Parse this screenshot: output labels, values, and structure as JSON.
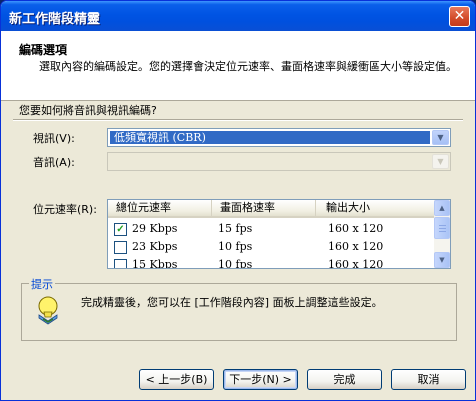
{
  "window": {
    "title": "新工作階段精靈",
    "close_glyph": "✕"
  },
  "header": {
    "title": "編碼選項",
    "description": "選取內容的編碼設定。您的選擇會決定位元速率、畫面格速率與緩衝區大小等設定值。"
  },
  "question": "您要如何將音訊與視訊編碼?",
  "video": {
    "label": "視訊(V):",
    "value": "低頻寬視訊 (CBR)"
  },
  "audio": {
    "label": "音訊(A):",
    "value": ""
  },
  "bitrate": {
    "label": "位元速率(R):",
    "columns": [
      "總位元速率",
      "畫面格速率",
      "輸出大小"
    ],
    "rows": [
      {
        "checked": true,
        "rate": "29 Kbps",
        "fps": "15 fps",
        "size": "160 x 120"
      },
      {
        "checked": false,
        "rate": "23 Kbps",
        "fps": "10 fps",
        "size": "160 x 120"
      },
      {
        "checked": false,
        "rate": "15 Kbps",
        "fps": "10 fps",
        "size": "160 x 120"
      }
    ]
  },
  "tips": {
    "label": "提示",
    "text": "完成精靈後，您可以在 [工作階段內容] 面板上調整這些設定。",
    "icon": "lightbulb-icon"
  },
  "buttons": {
    "back": "< 上一步(B)",
    "next": "下一步(N) >",
    "finish": "完成",
    "cancel": "取消"
  },
  "colors": {
    "title_bar": "#0054e3",
    "selection": "#316ac5",
    "face": "#ece9d8",
    "tips_label": "#0046d5"
  }
}
